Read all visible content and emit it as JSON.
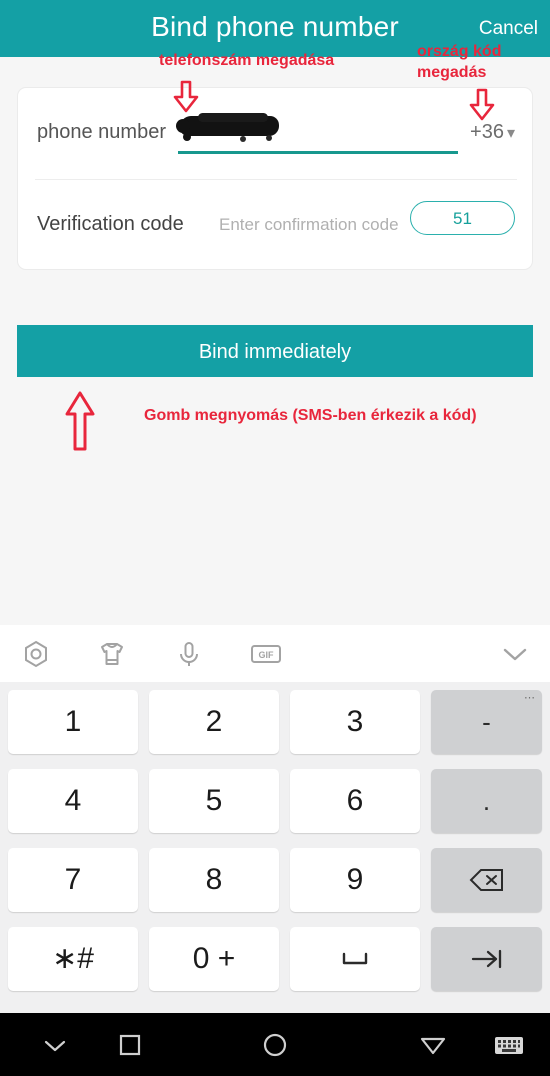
{
  "header": {
    "title": "Bind phone number",
    "cancel_label": "Cancel",
    "background_color": "#14a0a5"
  },
  "form": {
    "phone_row": {
      "label": "phone number",
      "value": "",
      "redacted": true,
      "country_code": "+36",
      "dropdown_icon": "chevron-down-icon"
    },
    "code_row": {
      "label": "Verification code",
      "placeholder": "Enter confirmation code",
      "value": "",
      "resend_label": "51"
    }
  },
  "primary_button": {
    "label": "Bind immediately",
    "color": "#14a0a5"
  },
  "annotations": {
    "color": "#e8263c",
    "phone_hint": "telefonszám megadása",
    "country_hint": "ország kód\nmegadás",
    "country_hint_line1": "ország kód",
    "country_hint_line2": "megadás",
    "press_hint": "Gomb megnyomás (SMS-ben érkezik a kód)",
    "arrows": [
      {
        "name": "arrow-down-phone",
        "direction": "down"
      },
      {
        "name": "arrow-down-country",
        "direction": "down"
      },
      {
        "name": "arrow-up-bind",
        "direction": "up"
      }
    ]
  },
  "keyboard": {
    "toolbar": [
      {
        "icon": "hexagon-settings-icon",
        "label": ""
      },
      {
        "icon": "tshirt-theme-icon",
        "label": ""
      },
      {
        "icon": "microphone-icon",
        "label": ""
      },
      {
        "icon": "gif-icon",
        "label": "GIF"
      },
      {
        "icon": "chevron-down-icon",
        "label": ""
      }
    ],
    "rows": [
      [
        {
          "key": "1",
          "type": "digit"
        },
        {
          "key": "2",
          "type": "digit"
        },
        {
          "key": "3",
          "type": "digit"
        },
        {
          "key": "-",
          "type": "function",
          "has_more": true
        }
      ],
      [
        {
          "key": "4",
          "type": "digit"
        },
        {
          "key": "5",
          "type": "digit"
        },
        {
          "key": "6",
          "type": "digit"
        },
        {
          "key": ".",
          "type": "function"
        }
      ],
      [
        {
          "key": "7",
          "type": "digit"
        },
        {
          "key": "8",
          "type": "digit"
        },
        {
          "key": "9",
          "type": "digit"
        },
        {
          "key": "backspace-icon",
          "type": "function"
        }
      ],
      [
        {
          "key": "∗#",
          "type": "digit"
        },
        {
          "key": "0 +",
          "type": "digit"
        },
        {
          "key": "␣",
          "type": "digit"
        },
        {
          "key": "tab-next-icon",
          "type": "function"
        }
      ]
    ]
  },
  "navbar": [
    {
      "icon": "chevron-down-icon",
      "name": "hide-keyboard"
    },
    {
      "icon": "square-icon",
      "name": "recents"
    },
    {
      "icon": "circle-icon",
      "name": "home"
    },
    {
      "icon": "triangle-down-icon",
      "name": "back"
    },
    {
      "icon": "keyboard-icon",
      "name": "switch-keyboard"
    }
  ]
}
